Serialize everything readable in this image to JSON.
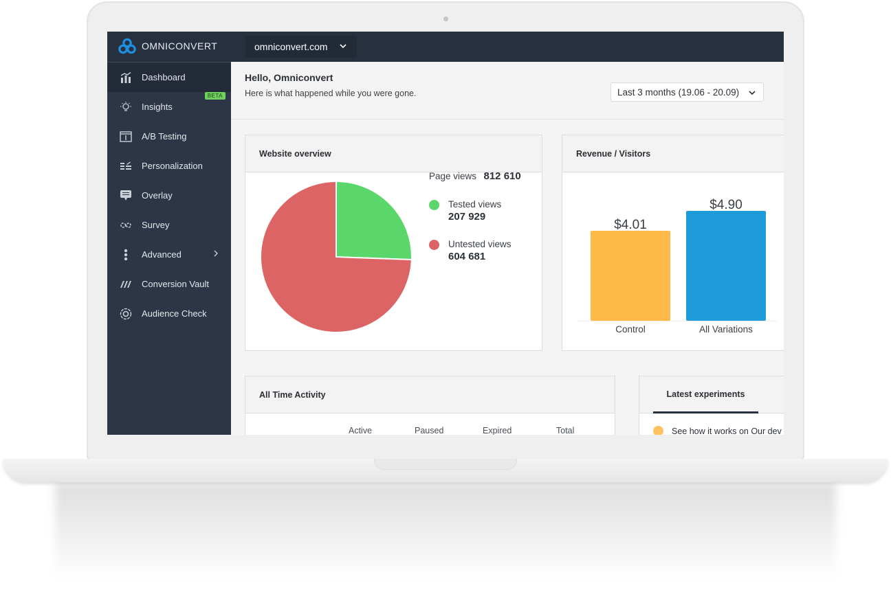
{
  "brand": {
    "name": "OMNICONVERT",
    "accent": "#1e8fe0"
  },
  "site_selector": {
    "value": "omniconvert.com"
  },
  "sidebar": {
    "items": [
      {
        "label": "Dashboard",
        "icon": "bar-chart-icon",
        "active": true
      },
      {
        "label": "Insights",
        "icon": "lightbulb-icon",
        "badge": "BETA"
      },
      {
        "label": "A/B Testing",
        "icon": "window-split-icon"
      },
      {
        "label": "Personalization",
        "icon": "personalization-icon"
      },
      {
        "label": "Overlay",
        "icon": "chat-bubble-icon"
      },
      {
        "label": "Survey",
        "icon": "infinity-icon"
      },
      {
        "label": "Advanced",
        "icon": "vertical-dots-icon",
        "has_submenu": true
      },
      {
        "label": "Conversion Vault",
        "icon": "vault-stripes-icon"
      },
      {
        "label": "Audience Check",
        "icon": "target-gear-icon"
      }
    ]
  },
  "greeting": {
    "title": "Hello, Omniconvert",
    "subtitle": "Here is what happened while you were gone."
  },
  "date_range": {
    "value": "Last 3 months (19.06 - 20.09)"
  },
  "website_overview": {
    "title": "Website overview",
    "page_views_label": "Page views",
    "page_views_value": "812 610",
    "legend": [
      {
        "label": "Tested views",
        "value": "207 929",
        "color": "#5bd66a"
      },
      {
        "label": "Untested views",
        "value": "604 681",
        "color": "#dc6464"
      }
    ]
  },
  "revenue_visitors": {
    "title": "Revenue / Visitors"
  },
  "all_time_activity": {
    "title": "All Time Activity",
    "columns": [
      "Active",
      "Paused",
      "Expired",
      "Total"
    ]
  },
  "latest_experiments": {
    "tab_label": "Latest experiments",
    "items": [
      {
        "label": "See how it works on Our dev",
        "color": "#ffc261"
      }
    ]
  },
  "chart_data": [
    {
      "type": "pie",
      "title": "Website overview",
      "categories": [
        "Tested views",
        "Untested views"
      ],
      "values": [
        207929,
        604681
      ],
      "colors": [
        "#5bd66a",
        "#dc6464"
      ],
      "total_label": "Page views",
      "total": 812610
    },
    {
      "type": "bar",
      "title": "Revenue / Visitors",
      "categories": [
        "Control",
        "All Variations"
      ],
      "values": [
        4.01,
        4.9
      ],
      "value_labels": [
        "$4.01",
        "$4.90"
      ],
      "colors": [
        "#ffb946",
        "#1e9cd9"
      ],
      "xlabel": "",
      "ylabel": "",
      "ylim": [
        0,
        4.9
      ]
    }
  ]
}
